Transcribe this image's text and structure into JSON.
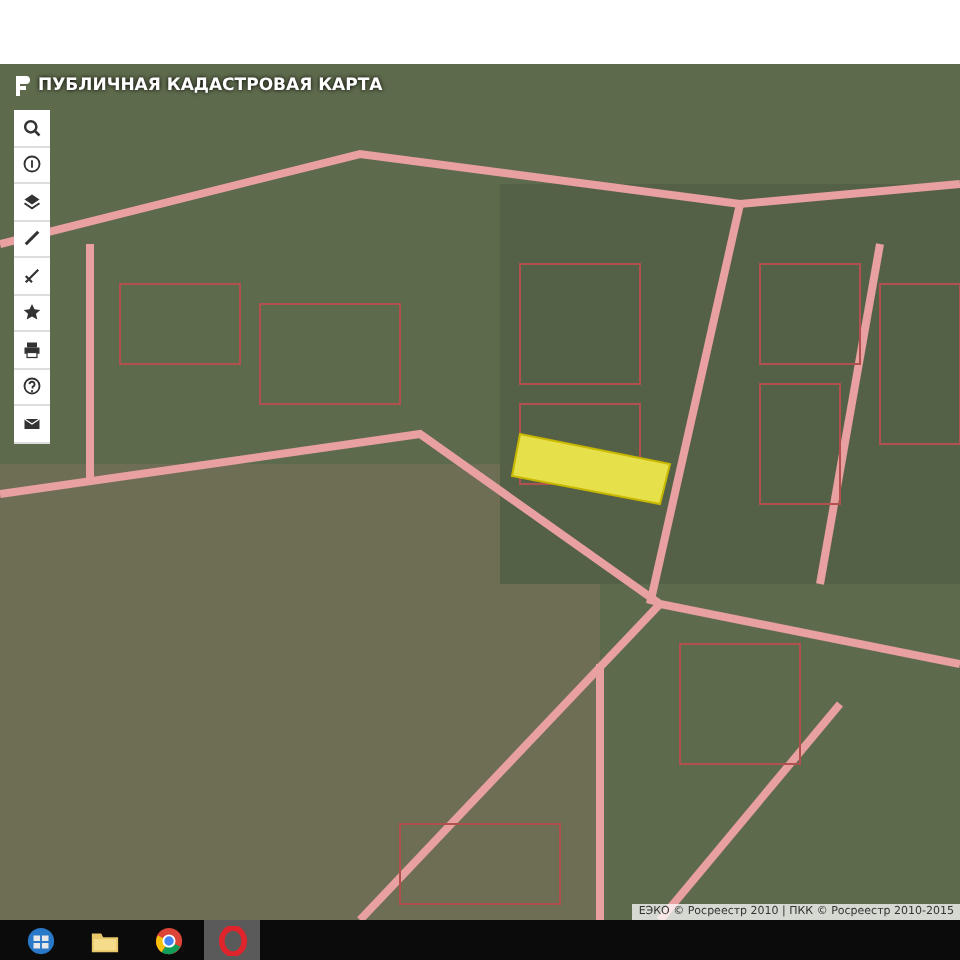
{
  "map": {
    "title": "ПУБЛИЧНАЯ КАДАСТРОВАЯ КАРТА",
    "attribution": "ЕЭКО © Росреестр 2010 | ПКК © Росреестр 2010-2015"
  },
  "toolbar": [
    {
      "kind": "search"
    },
    {
      "kind": "info"
    },
    {
      "kind": "layers"
    },
    {
      "kind": "ruler"
    },
    {
      "kind": "measure"
    },
    {
      "kind": "star"
    },
    {
      "kind": "print"
    },
    {
      "kind": "help"
    },
    {
      "kind": "mail"
    }
  ],
  "taskbar": [
    {
      "kind": "start",
      "selected": false
    },
    {
      "kind": "folder",
      "selected": false
    },
    {
      "kind": "chrome",
      "selected": false
    },
    {
      "kind": "opera",
      "selected": true
    }
  ]
}
